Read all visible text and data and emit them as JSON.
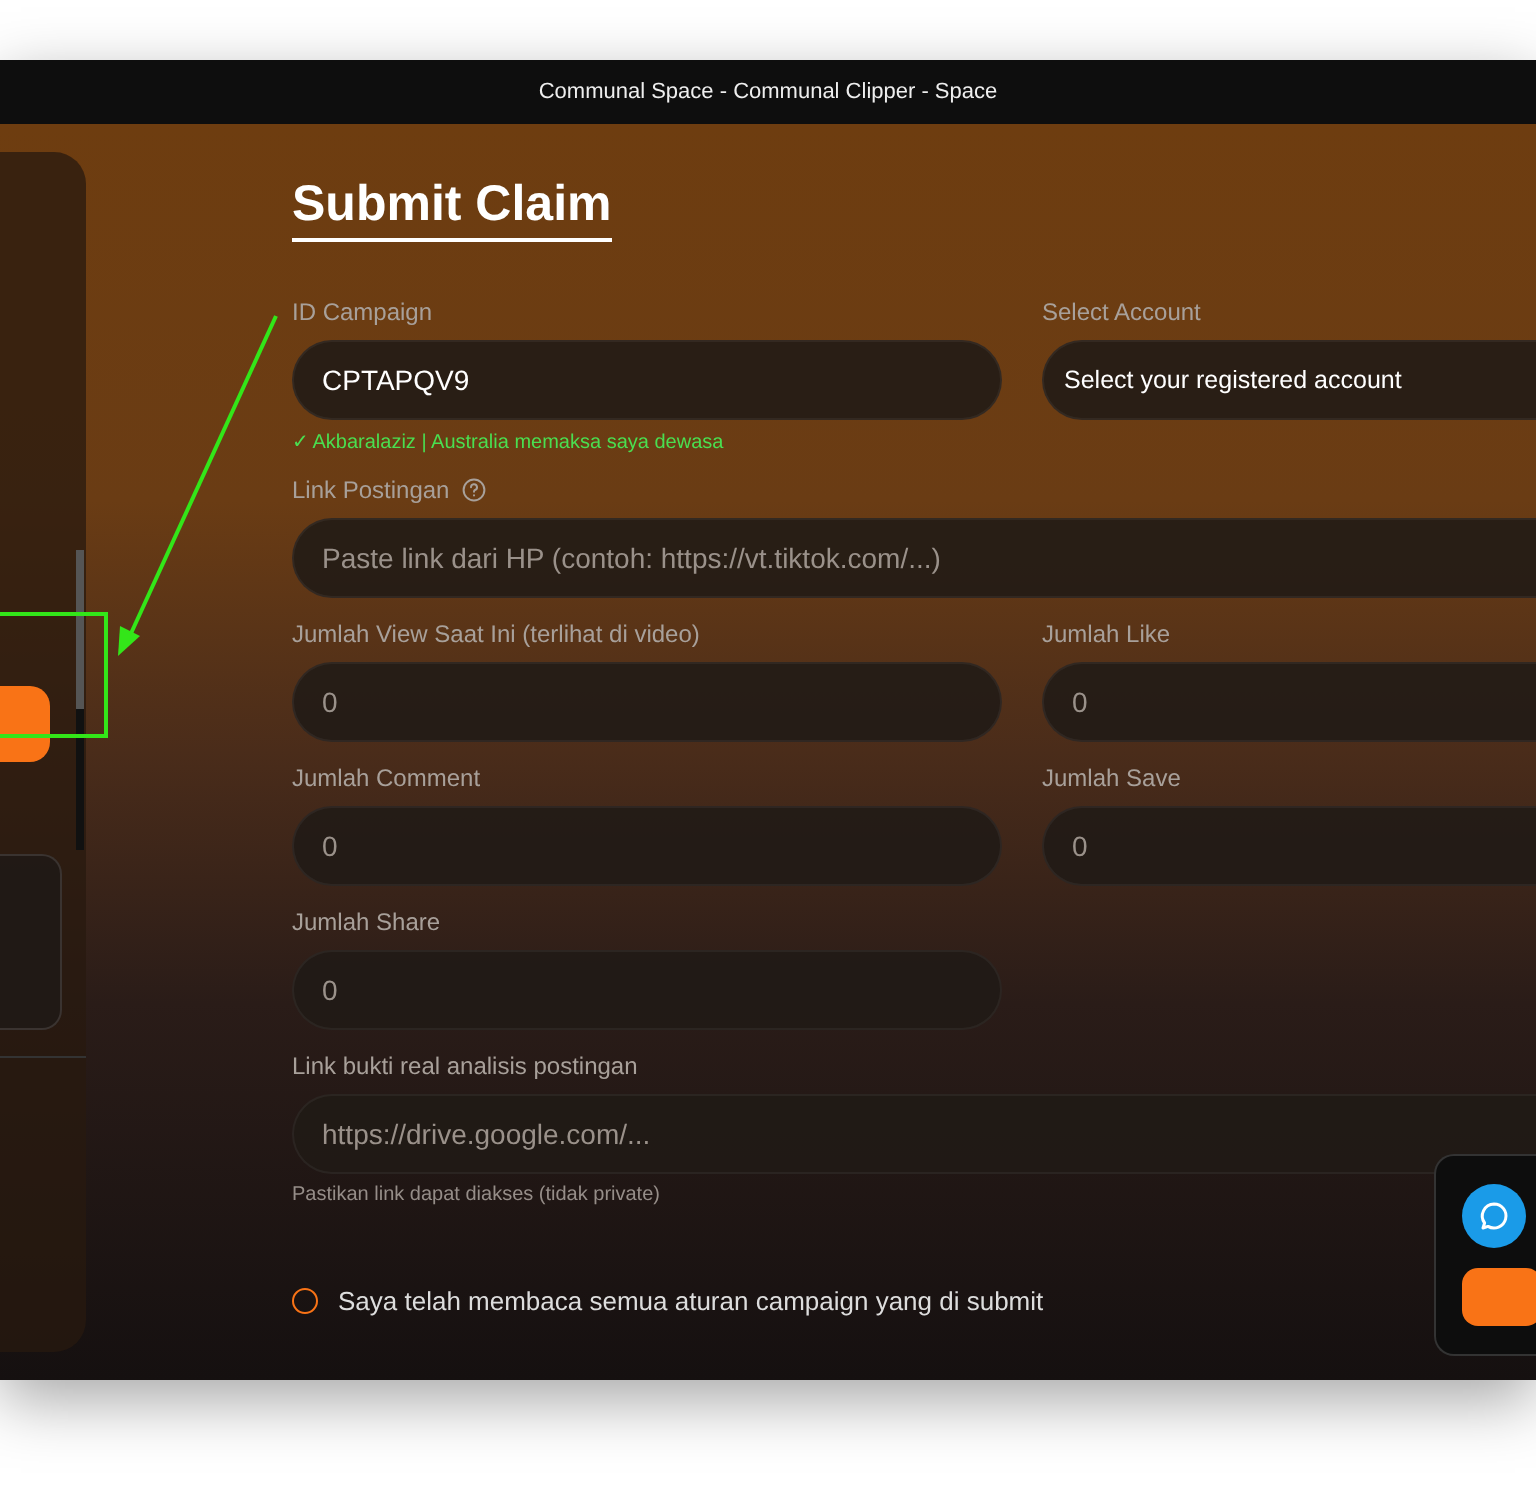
{
  "window": {
    "title": "Communal Space - Communal Clipper - Space"
  },
  "form": {
    "title": "Submit Claim",
    "rows": [
      [
        {
          "label": "ID Campaign",
          "kind": "input",
          "value": "CPTAPQV9",
          "note": "✓ Akbaralaziz | Australia memaksa saya dewasa"
        },
        {
          "label": "Select Account",
          "kind": "select",
          "value": "Select your registered account"
        }
      ],
      [
        {
          "label": "Link Postingan",
          "kind": "input",
          "help": true,
          "placeholder": "Paste link dari HP (contoh: https://vt.tiktok.com/...)"
        }
      ],
      [
        {
          "label": "Jumlah View Saat Ini (terlihat di video)",
          "kind": "input",
          "placeholder": "0"
        },
        {
          "label": "Jumlah Like",
          "kind": "input",
          "placeholder": "0"
        }
      ],
      [
        {
          "label": "Jumlah Comment",
          "kind": "input",
          "placeholder": "0"
        },
        {
          "label": "Jumlah Save",
          "kind": "input",
          "placeholder": "0"
        }
      ],
      [
        {
          "label": "Jumlah Share",
          "kind": "input",
          "placeholder": "0"
        }
      ],
      [
        {
          "label": "Link bukti real analisis postingan",
          "kind": "input",
          "placeholder": "https://drive.google.com/...",
          "hint": "Pastikan link dapat diakses (tidak private)"
        }
      ]
    ],
    "agreement": {
      "label": "Saya telah membaca semua aturan campaign yang di submit",
      "checked": false
    }
  }
}
